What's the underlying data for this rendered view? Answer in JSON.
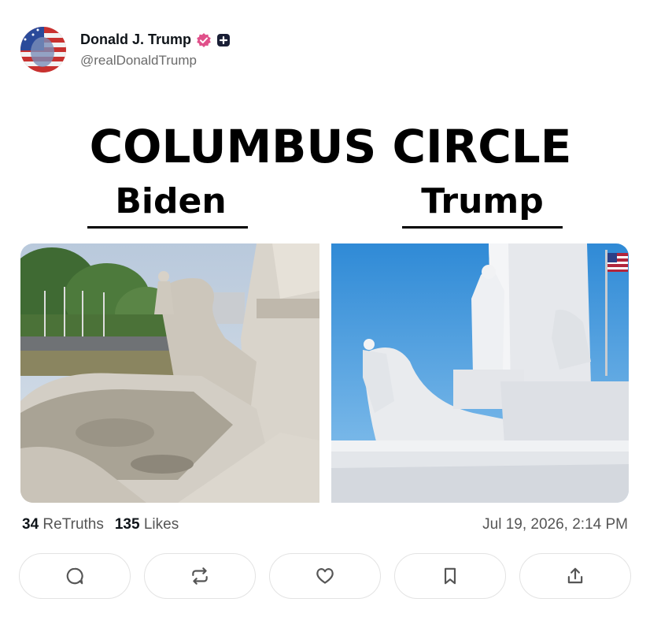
{
  "post": {
    "author_name": "Donald J. Trump",
    "handle": "@realDonaldTrump",
    "headline": "COLUMBUS CIRCLE",
    "left_label": "Biden",
    "right_label": "Trump",
    "retruths_count": "34",
    "retruths_label": "ReTruths",
    "likes_count": "135",
    "likes_label": "Likes",
    "timestamp": "Jul 19, 2026, 2:14 PM"
  },
  "colors": {
    "verified_badge": "#e0508a",
    "text_primary": "#0f1419",
    "text_secondary": "#6b6b6b"
  },
  "icons": {
    "verified": "verified-badge-icon",
    "plus": "plus-badge-icon",
    "reply": "reply-icon",
    "retruth": "retruth-icon",
    "like": "heart-icon",
    "bookmark": "bookmark-icon",
    "share": "share-icon"
  }
}
